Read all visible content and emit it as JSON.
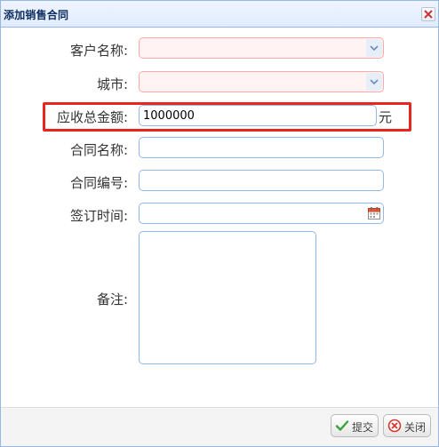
{
  "dialog": {
    "title": "添加销售合同",
    "close_icon": "close-icon"
  },
  "form": {
    "customer_name": {
      "label": "客户名称:",
      "value": "",
      "state": "invalid"
    },
    "city": {
      "label": "城市:",
      "value": "",
      "state": "invalid"
    },
    "receivable_amount": {
      "label": "应收总金额:",
      "value": "1000000",
      "unit": "元",
      "highlighted": true
    },
    "contract_name": {
      "label": "合同名称:",
      "value": ""
    },
    "contract_number": {
      "label": "合同编号:",
      "value": ""
    },
    "sign_time": {
      "label": "签订时间:",
      "value": "",
      "icon": "calendar-icon"
    },
    "remarks": {
      "label": "备注:",
      "value": ""
    }
  },
  "footer": {
    "submit_label": "提交",
    "close_label": "关闭"
  },
  "colors": {
    "title_bg": "#e0ecff",
    "border": "#95b8e7",
    "invalid_bg": "#fff3f3",
    "invalid_border": "#ffa8a8",
    "highlight": "#e8261d"
  }
}
